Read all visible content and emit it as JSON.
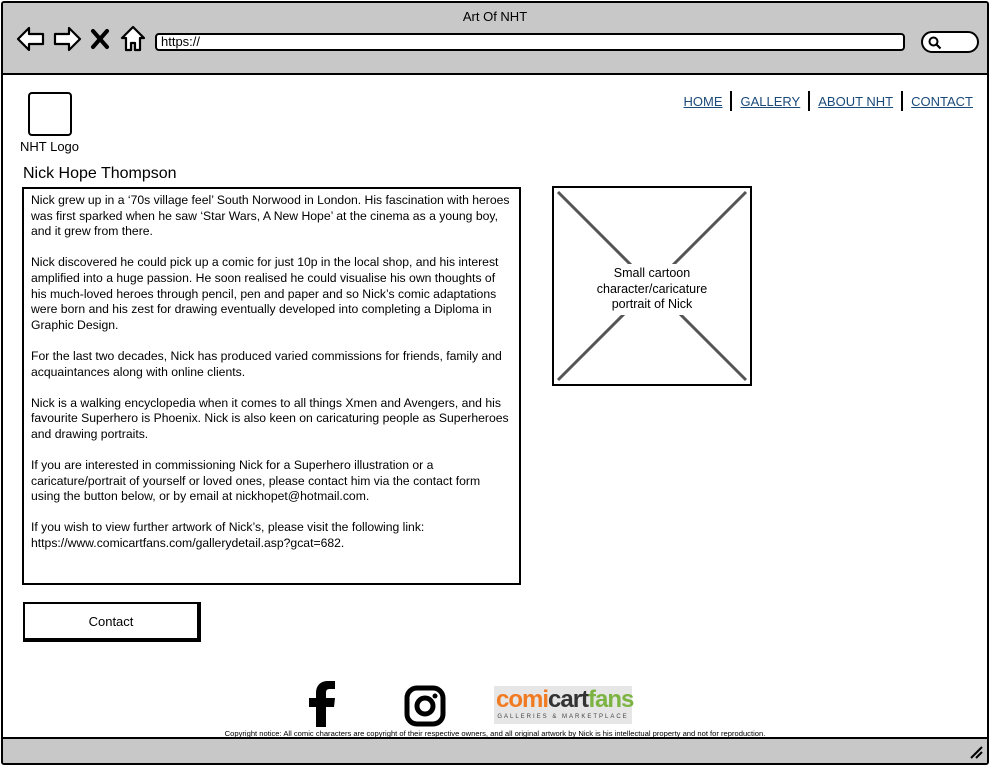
{
  "window": {
    "title": "Art Of NHT",
    "url": "https://"
  },
  "logo": {
    "label": "NHT Logo"
  },
  "nav": [
    {
      "label": "HOME"
    },
    {
      "label": "GALLERY"
    },
    {
      "label": "ABOUT NHT"
    },
    {
      "label": "CONTACT"
    }
  ],
  "about": {
    "heading": "Nick Hope Thompson",
    "paragraphs": [
      "Nick grew up in a ‘70s village feel’ South Norwood in London.  His fascination with heroes was first sparked when he saw ‘Star Wars, A New Hope’ at the cinema as a young boy, and it grew from there.",
      "Nick discovered he could pick up a comic for just 10p in the local shop, and his interest amplified into a huge passion.  He soon realised he could visualise his own thoughts of his much-loved heroes through pencil, pen and paper and so Nick’s comic adaptations were born and his zest for drawing eventually developed into completing a Diploma in Graphic Design.",
      "For the last two decades, Nick has produced varied commissions for friends, family and acquaintances along with online clients.",
      "Nick is a walking encyclopedia when it comes to all things Xmen and Avengers, and his favourite Superhero is Phoenix. Nick is also keen on caricaturing people as Superheroes and drawing portraits.",
      "If you are interested in commissioning Nick for a Superhero illustration or a caricature/portrait of yourself or loved ones, please contact him via the contact form using the button below, or by email at nickhopet@hotmail.com.",
      "If you wish to view further artwork of Nick’s, please visit the following link: https://www.comicartfans.com/gallerydetail.asp?gcat=682."
    ]
  },
  "portrait": {
    "caption": "Small cartoon character/caricature portrait of Nick"
  },
  "contact_button": {
    "label": "Contact"
  },
  "footer": {
    "comicartfans": {
      "brand_left": "comi",
      "brand_mid": "cart",
      "brand_right": "fans",
      "tagline": "GALLERIES & MARKETPLACE"
    },
    "copyright": "Copyright notice: All comic characters are copyright of their respective owners, and all original artwork by Nick is his intellectual property and not for reproduction."
  }
}
